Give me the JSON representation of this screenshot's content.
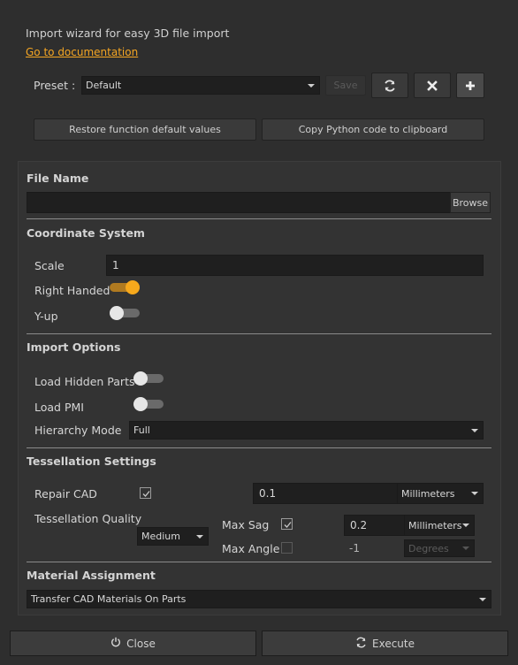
{
  "header": {
    "description": "Import wizard for easy 3D file import",
    "doc_link": "Go to documentation"
  },
  "preset": {
    "label": "Preset :",
    "selected": "Default",
    "save_label": "Save",
    "refresh_icon": "refresh-icon",
    "delete_icon": "close-icon",
    "add_icon": "plus-icon"
  },
  "actions": {
    "restore_label": "Restore function default values",
    "copy_label": "Copy Python code to clipboard"
  },
  "file_name": {
    "title": "File Name",
    "value": "",
    "browse_label": "Browse"
  },
  "coordinate_system": {
    "title": "Coordinate System",
    "scale_label": "Scale",
    "scale_value": "1",
    "right_handed_label": "Right Handed",
    "right_handed": true,
    "y_up_label": "Y-up",
    "y_up": false
  },
  "import_options": {
    "title": "Import Options",
    "hidden_parts_label": "Load Hidden Parts",
    "hidden_parts": false,
    "pmi_label": "Load PMI",
    "pmi": false,
    "hierarchy_label": "Hierarchy Mode",
    "hierarchy_value": "Full"
  },
  "tessellation": {
    "title": "Tessellation Settings",
    "repair_label": "Repair CAD",
    "repair_checked": true,
    "repair_value": "0.1",
    "repair_unit": "Millimeters",
    "quality_label": "Tessellation Quality",
    "quality_value": "Medium",
    "max_sag_label": "Max Sag",
    "max_sag_checked": true,
    "max_sag_value": "0.2",
    "max_sag_unit": "Millimeters",
    "max_angle_label": "Max Angle",
    "max_angle_checked": false,
    "max_angle_value": "-1",
    "max_angle_unit": "Degrees"
  },
  "material": {
    "title": "Material Assignment",
    "value": "Transfer CAD Materials On Parts"
  },
  "footer": {
    "close_label": "Close",
    "execute_label": "Execute"
  },
  "colors": {
    "accent": "#f5a623",
    "background": "#2e2e2e",
    "panel": "#333333",
    "field": "#1f1f1f"
  }
}
